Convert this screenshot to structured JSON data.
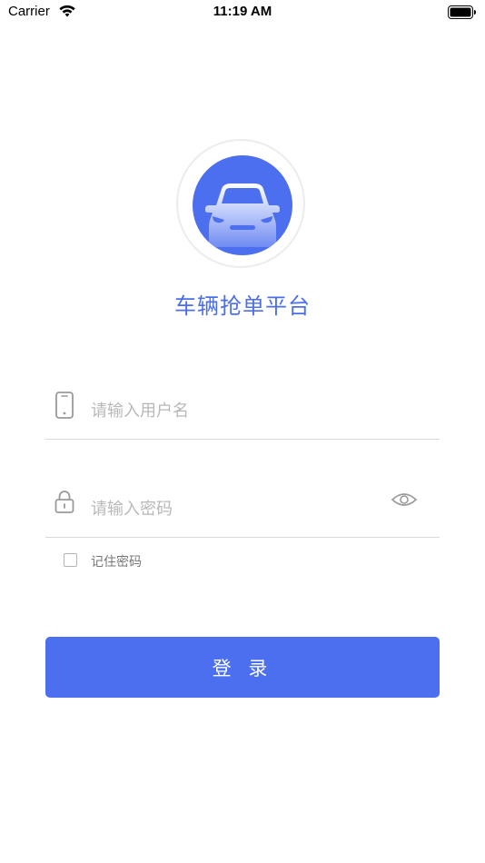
{
  "status_bar": {
    "carrier": "Carrier",
    "time": "11:19 AM"
  },
  "app": {
    "title": "车辆抢单平台",
    "accent_color": "#4c6ff0",
    "logo_icon": "car-icon"
  },
  "form": {
    "username": {
      "placeholder": "请输入用户名",
      "value": "",
      "icon": "phone-icon"
    },
    "password": {
      "placeholder": "请输入密码",
      "value": "",
      "icon": "lock-icon",
      "toggle_icon": "eye-icon"
    },
    "remember": {
      "label": "记住密码",
      "checked": false
    },
    "submit_label": "登 录"
  }
}
